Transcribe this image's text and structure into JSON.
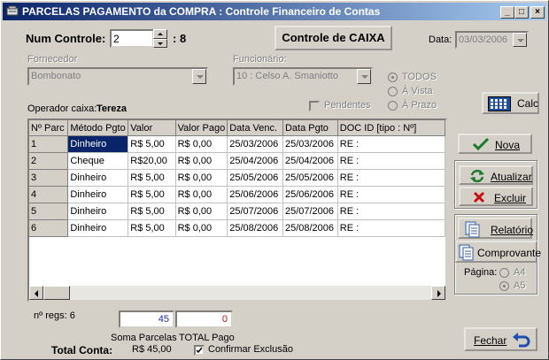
{
  "window": {
    "title": "PARCELAS PAGAMENTO da COMPRA : Controle Financeiro de Contas",
    "minimize_label": "_",
    "maximize_label": "□",
    "close_label": "×"
  },
  "header": {
    "num_controle_label": "Num Controle:",
    "num_controle_value": "2",
    "num_controle_total": ": 8",
    "controle_caixa_label": "Controle de CAIXA",
    "data_label": "Data:",
    "data_value": "03/03/2006"
  },
  "fornecedor": {
    "label": "Fornecedor",
    "value": "Bombonato"
  },
  "funcionario": {
    "label": "Funcionário:",
    "value": "10 : Celso A. Smaniotto"
  },
  "filters": {
    "todos": "TODOS",
    "a_vista": "À Vista",
    "a_prazo": "À Prazo",
    "pendentes": "Pendentes"
  },
  "operador": {
    "label": "Operador caixa:",
    "name": "Tereza"
  },
  "calc_label": "Calc",
  "grid": {
    "columns": [
      "Nº Parc",
      "Método Pgto",
      "Valor",
      "Valor Pago",
      "Data Venc.",
      "Data Pgto",
      "DOC ID [tipo : Nº]"
    ],
    "rows": [
      [
        "1",
        "Dinheiro",
        "R$  5,00",
        "R$  0,00",
        "25/03/2006",
        "25/03/2006",
        "RE :"
      ],
      [
        "2",
        "Cheque",
        "R$20,00",
        "R$  0,00",
        "25/04/2006",
        "25/04/2006",
        "RE :"
      ],
      [
        "3",
        "Dinheiro",
        "R$  5,00",
        "R$  0,00",
        "25/05/2006",
        "25/05/2006",
        "RE :"
      ],
      [
        "4",
        "Dinheiro",
        "R$  5,00",
        "R$  0,00",
        "25/06/2006",
        "25/06/2006",
        "RE :"
      ],
      [
        "5",
        "Dinheiro",
        "R$  5,00",
        "R$  0,00",
        "25/07/2006",
        "25/07/2006",
        "RE :"
      ],
      [
        "6",
        "Dinheiro",
        "R$  5,00",
        "R$  0,00",
        "25/08/2006",
        "25/08/2006",
        "RE :"
      ]
    ]
  },
  "actions": {
    "nova": "Nova",
    "atualizar": "Atualizar",
    "excluir": "Excluir",
    "relatorio": "Relatório",
    "comprovante": "Comprovante",
    "pagina_label": "Página:",
    "a4": "A4",
    "a5": "A5",
    "fechar": "Fechar"
  },
  "footer": {
    "nregs_label": "nº regs: 6",
    "soma_value": "45",
    "total_pago_value": "0",
    "soma_label": "Soma Parcelas",
    "total_pago_label": "TOTAL Pago",
    "total_conta_label": "Total Conta:",
    "total_conta_value": "R$ 45,00",
    "confirmar_label": "Confirmar Exclusão"
  }
}
